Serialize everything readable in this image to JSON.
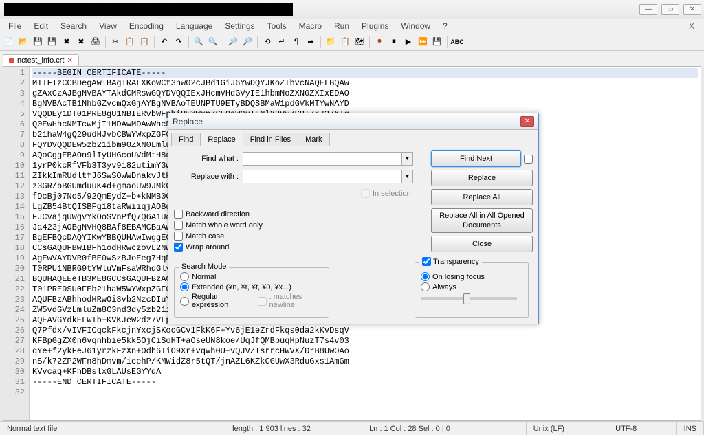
{
  "window": {
    "min": "—",
    "max": "▭",
    "close": "✕"
  },
  "menubar": {
    "items": [
      "File",
      "Edit",
      "Search",
      "View",
      "Encoding",
      "Language",
      "Settings",
      "Tools",
      "Macro",
      "Run",
      "Plugins",
      "Window",
      "?"
    ],
    "close": "X"
  },
  "tab": {
    "label": "nctest_info.crt",
    "close": "✕"
  },
  "editor": {
    "lines": [
      "-----BEGIN CERTIFICATE-----",
      "MIIFTzCCBDegAwIBAgIRALXKoWCt3nw02cJBd1GiJ6YwDQYJKoZIhvcNAQELBQAw",
      "gZAxCzAJBgNVBAYTAkdCMRswGQYDVQQIExJHcmVHdGVyIE1hbmNoZXN0ZXIxEDAO",
      "BgNVBAcTB1NhbGZvcmQxGjAYBgNVBAoTEUNPTU9ETyBDQSBMaW1pdGVkMTYwNAYD",
      "VQQDEy1DT01PRE8gU1NBIERvbWFpbiBWYWxpZGF0aW9uIFNlY3VyZSBTZXJ2ZXIg",
      "Q0EwHhcNMTcwMjI1MDAwMDAwWhcNMTgwMjI1MjM1OTU5WjBfMSEwHwYDVQQLExhE",
      "b21haW4gQ29udHJvbCBWYWxpZGF0ZWQxHjAcBgNVBAsTFUVzc2VudGlhbFNTTCBX",
      "FQYDVQQDEw5zb21ibm90ZXN0LmluZm8wggEiMA0GCSqGSIb3DQEBAQUAA4IBDwAw",
      "AQoCggEBAOn9lIyUHGcoUVdMtH8dKzE4rF+hczJ4M1f1FARLzsi5u0e1QBrR0Nob",
      "1yrP0kcRfVFb3T3yv9i82utimY3wBANFuMw6pO/KFP/6aPq0wXnzThqRUNe5HpY8",
      "ZIkkImRUdltfJ6SwSOwWDnakvJtH6NBVKzQwdZwfWqXkroX6afV7i3OdXLBrvwYG",
      "z3GR/bBGUmduuK4d+gmaoUW9JMkCAwEAAaOCAfUwggHxMB8GA1UdIwQYMBaAFJBC",
      "fDcBj07No5/92QmEydZ+b+kNMB0GA1UdDgQWBBQ7I06awVsRfvs6gZBhT5fi1Zfb",
      "LgZB54BtQISBFg18taRWiiqjAOBgNVHQ8BAf8EBAMCBaAwDAYDVR0TAQH/BAIwADAd",
      "FJCvajqUWgvYkOoSVnPfQ7Q6A1UdEQQnMCWCD3NvbWJub3Rlc3QuaW5mb4ISd3d3",
      "Ja423jAOBgNVHQ8BAf8EBAMCBaAwUAYDVR0fBEkwRzBFoEOgQYY/aHR0cDovL2Ny",
      "BgEFBQcDAQYIKwYBBQUHAwIwggEGBggrBgEFBQcBAQSB+TCB9jCBxgYIKwYBBQUH",
      "CCsGAQUFBwIBFh1odHRwczovL2Nwcy5jb21vZG9jYS5jb20vQ1BTMC8GA1UdHwQo",
      "AgEwVAYDVR0fBE0wSzBJoEeg7HqNzXoQuQKnPwLAvlLwXFDDkYlaTLTVZaZeIoybW",
      "T0RPU1NBRG9tYWluVmFsaWRhdGlvblNlY3VyZVNlcnZlckNBLmNybDCBhQYIKwYB",
      "BQUHAQEEeTB3ME8GCCsGAQUFBzAChkNodHRwOi8vY3J0LmNvbW9kb2NhLmNvbS9D",
      "T01PRE9SU0FEb21haW5WYWxpZGF0aW9uU2VjdXJlU2VydmVyQ0EuY3J0MCQGCCsG",
      "AQUFBzABhhodHRwOi8vb2NzcDIuY29tb2RvY2EuY29tMDcGA1UdEQQwMC6CD25j",
      "ZW5vdGVzLmluZm8C3nd3dy5zb21ibm90ZXN0LmluZm8wDQYJKoZIhvcNAQELBQAD",
      "AQEAVGYdkELWIb+KVKJeW2dz7VLpkY4JDNvxRMY7mFi2vXlJTrAwRjXYExqq5ipr",
      "Q7Pfdx/vIVFICqckFkcjnYxcjSKooGCv1FkK6F+Yv6jE1eZrdFkqs0da2kKvDsqV",
      "KFBpGgZX0n6vqnhbie5kk5OjCiSoHT+aOseUN8koe/UqJfQMBpuqHpNuzT7s4v03",
      "qYe+f2ykFeJ61yrzkFzXn+Odh6TiO9Xr+vqwh0U+vQJVZTsrrcHWVX/DrB8UwOAo",
      "nS/k72ZP2WFn8hDmvm/icehP/KMWidZ8r5tQT/jnAZL6KZkCGUwX3RduGxs1AmGm",
      "KVvcaq+KFhDBslxGLAUsEGYYdA==",
      "-----END CERTIFICATE-----",
      ""
    ]
  },
  "dialog": {
    "title": "Replace",
    "tabs": [
      "Find",
      "Replace",
      "Find in Files",
      "Mark"
    ],
    "find_label": "Find what :",
    "replace_label": "Replace with :",
    "in_selection": "In selection",
    "backward": "Backward direction",
    "whole_word": "Match whole word only",
    "match_case": "Match case",
    "wrap": "Wrap around",
    "mode_legend": "Search Mode",
    "mode_normal": "Normal",
    "mode_extended": "Extended (¥n, ¥r, ¥t, ¥0, ¥x...)",
    "mode_regex": "Regular expression",
    "mode_newline": ". matches newline",
    "trans_legend": "Transparency",
    "trans_losing": "On losing focus",
    "trans_always": "Always",
    "btn_findnext": "Find Next",
    "btn_replace": "Replace",
    "btn_replaceall": "Replace All",
    "btn_replaceall_docs": "Replace All in All Opened Documents",
    "btn_close": "Close"
  },
  "status": {
    "file": "Normal text file",
    "length": "length : 1 903    lines : 32",
    "pos": "Ln : 1    Col : 28    Sel : 0 | 0",
    "eol": "Unix (LF)",
    "enc": "UTF-8",
    "ins": "INS"
  }
}
